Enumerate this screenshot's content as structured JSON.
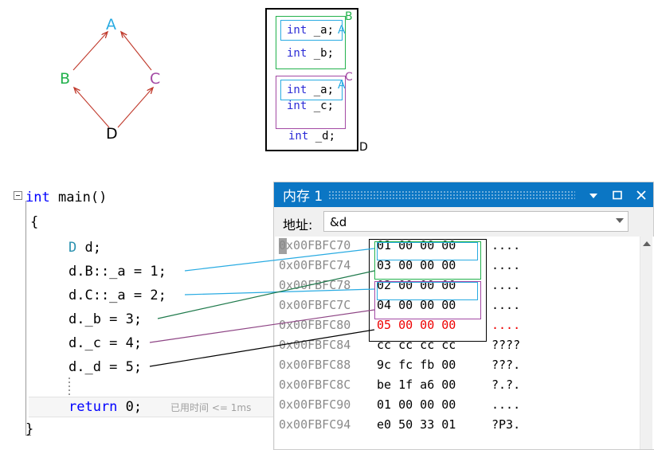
{
  "inheritance_diagram": {
    "nodes": [
      {
        "label": "A",
        "color": "#29ABE2"
      },
      {
        "label": "B",
        "color": "#22B14C"
      },
      {
        "label": "C",
        "color": "#A349A4"
      },
      {
        "label": "D",
        "color": "#000000"
      }
    ],
    "edges": [
      {
        "from": "B",
        "to": "A"
      },
      {
        "from": "C",
        "to": "A"
      },
      {
        "from": "D",
        "to": "B"
      },
      {
        "from": "D",
        "to": "C"
      }
    ],
    "arrow_color": "#C0392B"
  },
  "layout_diagram": {
    "outer_label": "D",
    "group_b_label": "B",
    "group_c_label": "C",
    "a_tag_1": "A",
    "a_tag_2": "A",
    "members": {
      "b_a": {
        "keyword": "int",
        "name": " _a;"
      },
      "b_b": {
        "keyword": "int",
        "name": " _b;"
      },
      "c_a": {
        "keyword": "int",
        "name": " _a;"
      },
      "c_c": {
        "keyword": "int",
        "name": " _c;"
      },
      "d_d": {
        "keyword": "int",
        "name": " _d;"
      }
    }
  },
  "code": {
    "signature_keyword": "int",
    "signature_rest": " main()",
    "open_brace": "{",
    "close_brace": "}",
    "lines": [
      {
        "type_part": "D",
        "rest": " d;"
      },
      {
        "type_part": "",
        "rest": "d.B::_a = 1;"
      },
      {
        "type_part": "",
        "rest": "d.C::_a = 2;"
      },
      {
        "type_part": "",
        "rest": "d._b = 3;"
      },
      {
        "type_part": "",
        "rest": "d._c = 4;"
      },
      {
        "type_part": "",
        "rest": "d._d = 5;"
      }
    ],
    "return_keyword": "return",
    "return_rest": " 0;",
    "elapsed_label": "已用时间 <= 1ms"
  },
  "memory_window": {
    "title": "内存 1",
    "dropdown_icon": "chevron-down-icon",
    "maximize_icon": "maximize-icon",
    "close_icon": "close-icon",
    "overflow_icon": "»",
    "address_label": "地址:",
    "address_value": "&d",
    "address_placeholder": "&d",
    "rows": [
      {
        "address": "0x00FBFC70",
        "hex": "01 00 00 00",
        "ascii": "....",
        "changed": false
      },
      {
        "address": "0x00FBFC74",
        "hex": "03 00 00 00",
        "ascii": "....",
        "changed": false
      },
      {
        "address": "0x00FBFC78",
        "hex": "02 00 00 00",
        "ascii": "....",
        "changed": false
      },
      {
        "address": "0x00FBFC7C",
        "hex": "04 00 00 00",
        "ascii": "....",
        "changed": false
      },
      {
        "address": "0x00FBFC80",
        "hex": "05 00 00 00",
        "ascii": "....",
        "changed": true
      },
      {
        "address": "0x00FBFC84",
        "hex": "cc cc cc cc",
        "ascii": "????",
        "changed": false
      },
      {
        "address": "0x00FBFC88",
        "hex": "9c fc fb 00",
        "ascii": "???.",
        "changed": false
      },
      {
        "address": "0x00FBFC8C",
        "hex": "be 1f a6 00",
        "ascii": "?.?.",
        "changed": false
      },
      {
        "address": "0x00FBFC90",
        "hex": "01 00 00 00",
        "ascii": "....",
        "changed": false
      },
      {
        "address": "0x00FBFC94",
        "hex": "e0 50 33 01",
        "ascii": "?P3.",
        "changed": false
      }
    ]
  },
  "colors": {
    "class_a": "#29ABE2",
    "class_b": "#22B14C",
    "class_c": "#A349A4",
    "class_d": "#000000",
    "changed_value": "#ee0000",
    "titlebar": "#0b76c4",
    "arrow": "#C0392B"
  }
}
